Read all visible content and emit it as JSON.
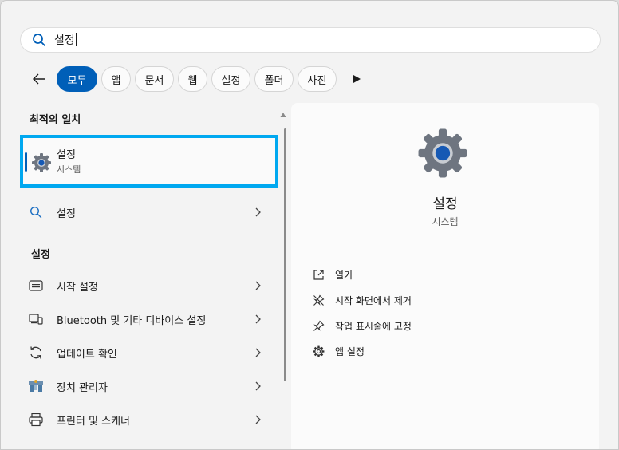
{
  "search": {
    "value": "설정",
    "icon": "search-icon"
  },
  "filters": {
    "back_icon": "back-arrow-icon",
    "pills": [
      "모두",
      "앱",
      "문서",
      "웹",
      "설정",
      "폴더",
      "사진"
    ],
    "more_icon": "play-more-icon"
  },
  "best_match": {
    "heading": "최적의 일치",
    "title": "설정",
    "subtitle": "시스템",
    "icon": "settings-gear-icon"
  },
  "web_search": {
    "label": "설정",
    "icon": "search-icon"
  },
  "settings_section": {
    "heading": "설정",
    "items": [
      {
        "label": "시작 설정",
        "icon": "start-settings-icon"
      },
      {
        "label": "Bluetooth 및 기타 디바이스 설정",
        "icon": "devices-icon"
      },
      {
        "label": "업데이트 확인",
        "icon": "update-icon"
      },
      {
        "label": "장치 관리자",
        "icon": "device-manager-icon"
      },
      {
        "label": "프린터 및 스캐너",
        "icon": "printer-icon"
      }
    ]
  },
  "detail": {
    "title": "설정",
    "subtitle": "시스템",
    "actions": [
      {
        "label": "열기",
        "icon": "open-external-icon"
      },
      {
        "label": "시작 화면에서 제거",
        "icon": "unpin-icon"
      },
      {
        "label": "작업 표시줄에 고정",
        "icon": "pin-icon"
      },
      {
        "label": "앱 설정",
        "icon": "gear-icon"
      }
    ]
  },
  "colors": {
    "accent": "#005fb8",
    "highlight": "#00a8f0",
    "background": "#f3f3f3"
  }
}
